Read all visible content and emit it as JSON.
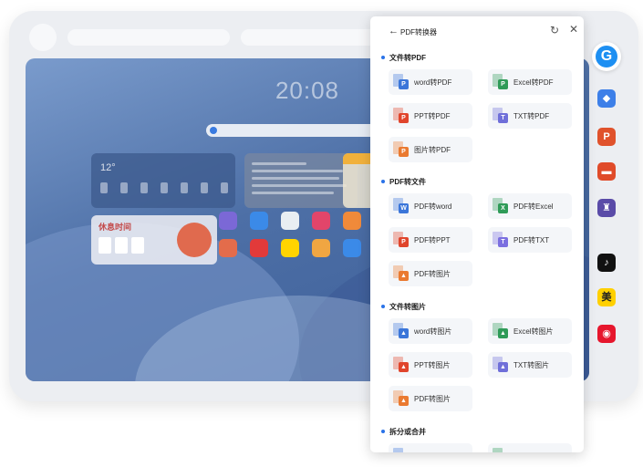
{
  "desktop": {
    "clock": "20:08",
    "weather_temp": "12°",
    "holiday_title": "休息时间"
  },
  "panel": {
    "back_glyph": "←",
    "title": "PDF转换器",
    "refresh_glyph": "↻",
    "close_glyph": "✕",
    "sections": [
      {
        "title": "文件转PDF",
        "items": [
          {
            "label": "word转PDF",
            "icon": "word-to-pdf-icon",
            "color": "#3b76d9",
            "badge": "P"
          },
          {
            "label": "Excel转PDF",
            "icon": "excel-to-pdf-icon",
            "color": "#2f9b58",
            "badge": "P"
          },
          {
            "label": "PPT转PDF",
            "icon": "ppt-to-pdf-icon",
            "color": "#e0452c",
            "badge": "P"
          },
          {
            "label": "TXT转PDF",
            "icon": "txt-to-pdf-icon",
            "color": "#6f6fd9",
            "badge": "T"
          },
          {
            "label": "图片转PDF",
            "icon": "image-to-pdf-icon",
            "color": "#ea7a30",
            "badge": "P"
          }
        ]
      },
      {
        "title": "PDF转文件",
        "items": [
          {
            "label": "PDF转word",
            "icon": "pdf-to-word-icon",
            "color": "#3b76d9",
            "badge": "W"
          },
          {
            "label": "PDF转Excel",
            "icon": "pdf-to-excel-icon",
            "color": "#2f9b58",
            "badge": "X"
          },
          {
            "label": "PDF转PPT",
            "icon": "pdf-to-ppt-icon",
            "color": "#e0452c",
            "badge": "P"
          },
          {
            "label": "PDF转TXT",
            "icon": "pdf-to-txt-icon",
            "color": "#7b6fe0",
            "badge": "T"
          },
          {
            "label": "PDF转图片",
            "icon": "pdf-to-image-icon",
            "color": "#ea7a30",
            "badge": "▲"
          }
        ]
      },
      {
        "title": "文件转图片",
        "items": [
          {
            "label": "word转图片",
            "icon": "word-to-image-icon",
            "color": "#3b76d9",
            "badge": "▲"
          },
          {
            "label": "Excel转图片",
            "icon": "excel-to-image-icon",
            "color": "#2f9b58",
            "badge": "▲"
          },
          {
            "label": "PPT转图片",
            "icon": "ppt-to-image-icon",
            "color": "#e0452c",
            "badge": "▲"
          },
          {
            "label": "TXT转图片",
            "icon": "txt-to-image-icon",
            "color": "#6f6fd9",
            "badge": "▲"
          },
          {
            "label": "PDF转图片",
            "icon": "pdf-to-image-icon-2",
            "color": "#ea7a30",
            "badge": "▲"
          }
        ]
      },
      {
        "title": "拆分或合并",
        "items": [
          {
            "label": "",
            "icon": "split-icon",
            "color": "#3b76d9",
            "badge": ""
          },
          {
            "label": "",
            "icon": "merge-icon",
            "color": "#2f9b58",
            "badge": ""
          }
        ]
      }
    ]
  },
  "dock": {
    "items": [
      {
        "name": "tag-app-icon",
        "color": "#3d7fe8",
        "glyph": "◆"
      },
      {
        "name": "powerpoint-app-icon",
        "color": "#e0522c",
        "glyph": "P"
      },
      {
        "name": "toolbox-app-icon",
        "color": "#e04b2a",
        "glyph": "▬"
      },
      {
        "name": "chess-app-icon",
        "color": "#5a4ba8",
        "glyph": "♜"
      },
      {
        "name": "tiktok-app-icon",
        "color": "#111111",
        "glyph": "♪"
      },
      {
        "name": "meituan-app-icon",
        "color": "#ffd000",
        "glyph": "美"
      },
      {
        "name": "weibo-app-icon",
        "color": "#e6162d",
        "glyph": "◉"
      }
    ]
  }
}
